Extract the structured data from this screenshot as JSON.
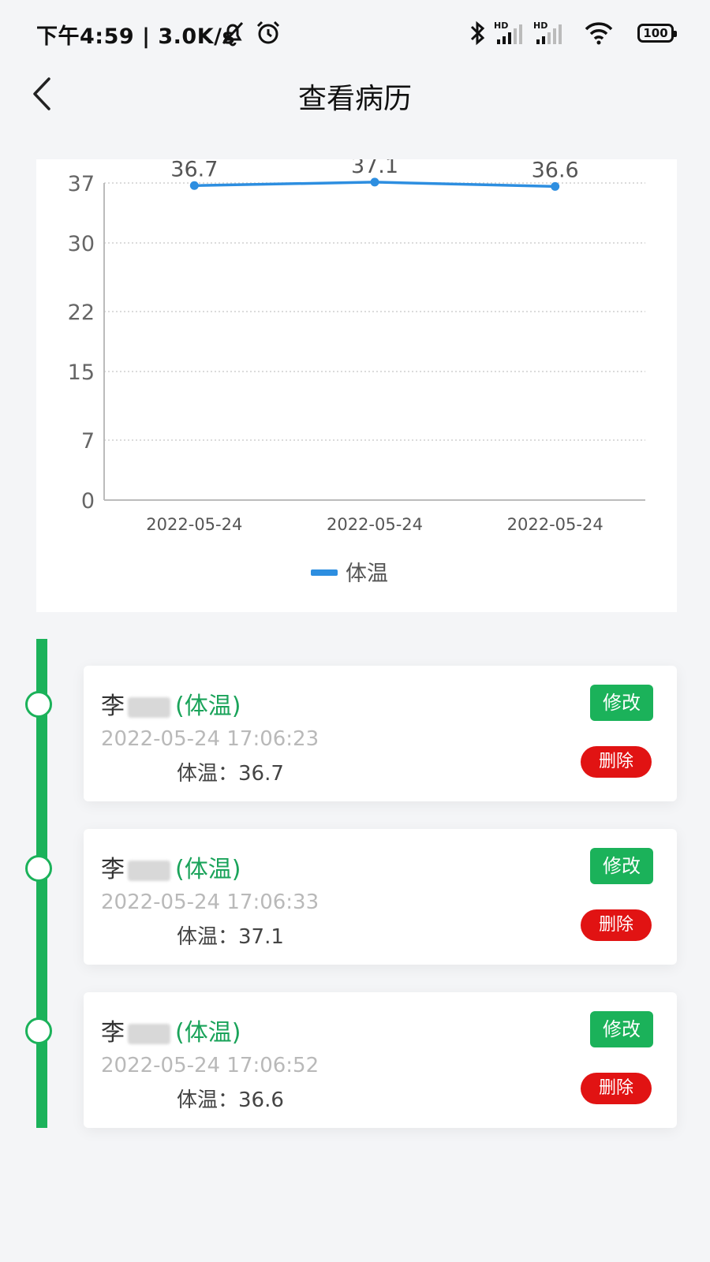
{
  "status_bar": {
    "time": "下午4:59",
    "network_speed": "3.0K/s",
    "separator": "|",
    "battery": "100",
    "icons": [
      "mute-icon",
      "alarm-icon",
      "bluetooth-icon",
      "hd-signal-icon",
      "hd-signal-icon",
      "wifi-icon",
      "battery-icon"
    ]
  },
  "header": {
    "title": "查看病历",
    "back_icon": "chevron-left-icon"
  },
  "chart_data": {
    "type": "line",
    "categories": [
      "2022-05-24",
      "2022-05-24",
      "2022-05-24"
    ],
    "series": [
      {
        "name": "体温",
        "values": [
          36.7,
          37.1,
          36.6
        ],
        "color": "#2d8ee0"
      }
    ],
    "y_ticks": [
      "0",
      "7",
      "15",
      "22",
      "30",
      "37"
    ],
    "ylim": [
      0,
      37
    ],
    "grid": true,
    "legend": "bottom-center"
  },
  "records": [
    {
      "name": "李",
      "type": "(体温)",
      "time": "2022-05-24 17:06:23",
      "value": "体温：36.7",
      "edit": "修改",
      "delete": "删除"
    },
    {
      "name": "李",
      "type": "(体温)",
      "time": "2022-05-24 17:06:33",
      "value": "体温：37.1",
      "edit": "修改",
      "delete": "删除"
    },
    {
      "name": "李",
      "type": "(体温)",
      "time": "2022-05-24 17:06:52",
      "value": "体温：36.6",
      "edit": "修改",
      "delete": "删除"
    }
  ],
  "colors": {
    "accent": "#1bb25a",
    "danger": "#e11313",
    "series": "#2d8ee0"
  }
}
